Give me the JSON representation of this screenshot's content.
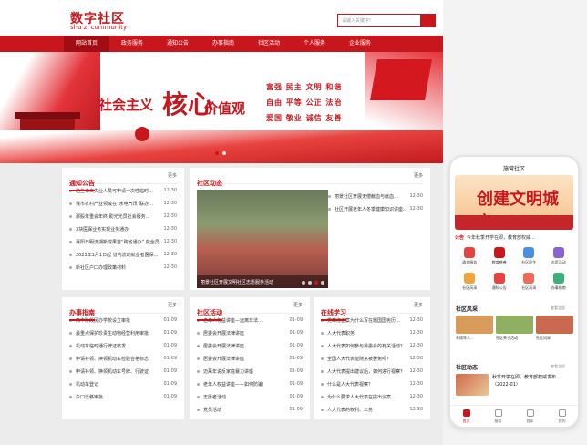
{
  "site": {
    "logo_cn": "数字社区",
    "logo_en": "shu zi community",
    "search_placeholder": "请输入关键字!",
    "nav": [
      "网站首页",
      "政务服务",
      "通知公告",
      "办事指南",
      "社区活动",
      "个人服务",
      "企业服务"
    ],
    "banner": {
      "slogan_left": "社会主义",
      "slogan_big": "核心",
      "slogan_right": "价值观",
      "values": [
        "富强  民主  文明  和谐",
        "自由  平等  公正  法治",
        "爱国  敬业  诚信  友善"
      ]
    },
    "panels": {
      "notice": {
        "title": "通知公告",
        "more": "更多",
        "items": [
          {
            "text": "这些本来失业人员可申请一次性临时…",
            "date": "12-30"
          },
          {
            "text": "我市农村产业领域在“水电气讯”联办…",
            "date": "12-30"
          },
          {
            "text": "那股年重会年终 助光光员社会服务…",
            "date": "12-30"
          },
          {
            "text": "3块医保业务实现业务通办",
            "date": "12-30"
          },
          {
            "text": "襄阳日明流湖新成果首“跨省通办” 获全员…",
            "date": "12-30"
          },
          {
            "text": "2021年1月1日起 省内流动就业者医保…",
            "date": "12-30"
          },
          {
            "text": "新社区户口办理政策材料",
            "date": "12-30"
          }
        ]
      },
      "activity_top": {
        "title": "社区动态",
        "more": "更多",
        "photo_caption": "丽景社区开展文明社区志愿服务活动",
        "items": [
          {
            "text": "丽景社区开展无偿献血与献血…",
            "date": "12-30"
          },
          {
            "text": "社区开展老年人冬季健康知识讲座…",
            "date": "12-30"
          }
        ]
      },
      "guide": {
        "title": "办事指南",
        "more": "更多",
        "items": [
          {
            "text": "高中阶段民办学校设立审批",
            "date": "01-09"
          },
          {
            "text": "最重点保护珍贵生动物经营利用审批",
            "date": "01-09"
          },
          {
            "text": "机动车临时通行牌证核发",
            "date": "01-09"
          },
          {
            "text": "申请补领、换领机动车检验合格标志",
            "date": "01-09"
          },
          {
            "text": "申请补领、换领机动车号牌、行驶证",
            "date": "01-09"
          },
          {
            "text": "机动车登记",
            "date": "01-09"
          },
          {
            "text": "户口迁移审批",
            "date": "01-09"
          }
        ]
      },
      "events": {
        "title": "社区活动",
        "more": "更多",
        "items": [
          {
            "text": "老年人权益讲座—远离非法…",
            "date": "01-09"
          },
          {
            "text": "居委会开展法律讲座",
            "date": "01-09"
          },
          {
            "text": "居委会开展法律讲座",
            "date": "01-09"
          },
          {
            "text": "居委会开展法律讲座",
            "date": "01-09"
          },
          {
            "text": "迈萬年说反家庭暴力讲座",
            "date": "01-09"
          },
          {
            "text": "老年人权益讲座——如何防骗",
            "date": "01-09"
          },
          {
            "text": "志愿者活动",
            "date": "01-09"
          },
          {
            "text": "党员活动",
            "date": "01-09"
          }
        ]
      },
      "study": {
        "title": "在线学习",
        "more": "更多",
        "items": [
          {
            "text": "党章修正案为什么写在题国国宪历…",
            "date": "12-30"
          },
          {
            "text": "人大代表职务",
            "date": "12-30"
          },
          {
            "text": "人大代表如何参与界委会的有关活动？",
            "date": "12-30"
          },
          {
            "text": "全国人大代表能随意被罢免吗？",
            "date": "12-30"
          },
          {
            "text": "人大代表提出建议后，如何进行视察？",
            "date": "12-30"
          },
          {
            "text": "什么是人大代表视察？",
            "date": "12-30"
          },
          {
            "text": "为什么要求人大代表在提出议案…",
            "date": "12-30"
          },
          {
            "text": "人大代表的权利、义务",
            "date": "12-30"
          }
        ]
      }
    }
  },
  "phone": {
    "title": "施营社区",
    "banner_text": "创建文明城市",
    "notice_tag": "公告",
    "notice_text": "今年秋季开学在即，教育部权威…",
    "grid": [
      {
        "label": "政务服务",
        "color": "#e8423f"
      },
      {
        "label": "教育慈善",
        "color": "#c8161d"
      },
      {
        "label": "社区民生",
        "color": "#4a8fe0"
      },
      {
        "label": "志愿活动",
        "color": "#8a63d2"
      },
      {
        "label": "社区风采",
        "color": "#f0a53a"
      },
      {
        "label": "通知公告",
        "color": "#e8423f"
      },
      {
        "label": "社区风采",
        "color": "#f06a5a"
      },
      {
        "label": "办事指南",
        "color": "#3bb07a"
      }
    ],
    "section1": "社区风采",
    "section1_more": "查看全部",
    "cards": [
      {
        "label": "未成年人…",
        "color": "#d89b5a"
      },
      {
        "label": "社区亲子活动",
        "color": "#8fb060"
      },
      {
        "label": "社区风采",
        "color": "#c96a50"
      }
    ],
    "section2": "社区动态",
    "section2_more": "查看全部",
    "news_text": "秋季开学在即，教育部权威发布（2022-01）",
    "tabs": [
      "首页",
      "服务",
      "我家",
      "我的"
    ]
  }
}
